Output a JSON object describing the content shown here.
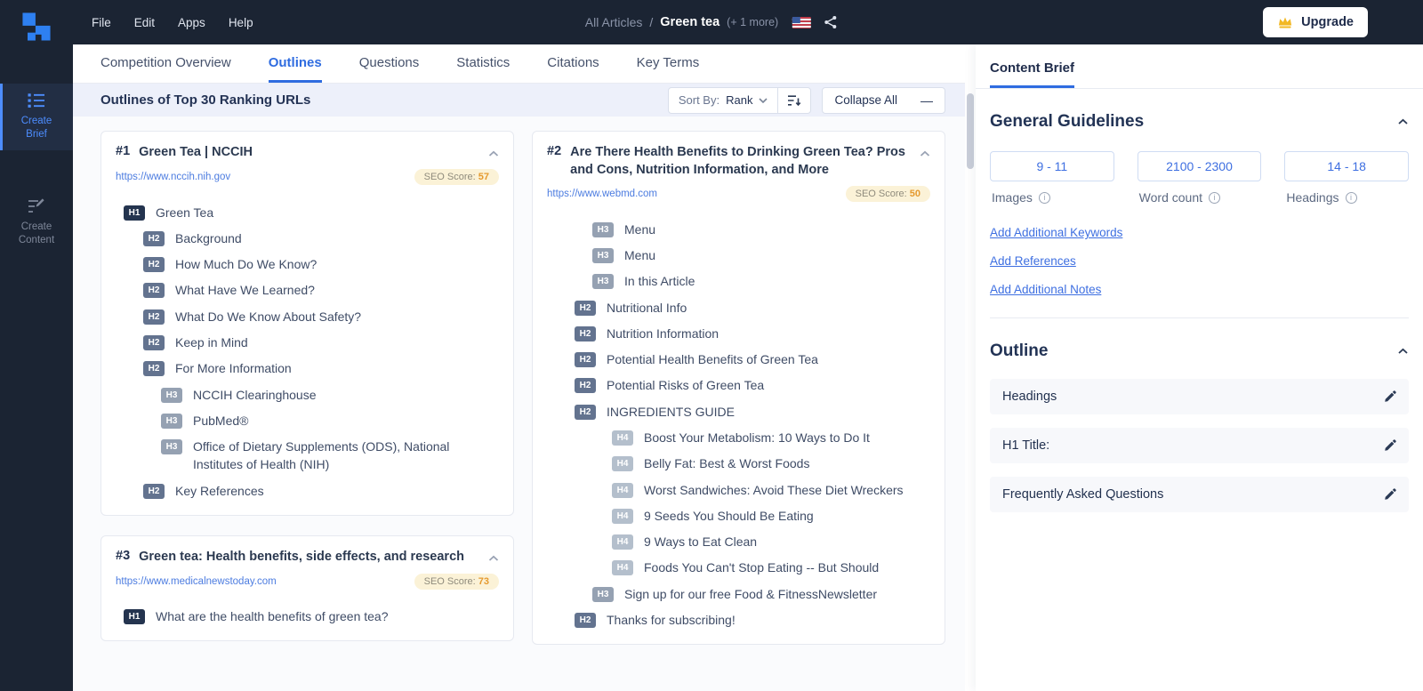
{
  "colors": {
    "accent": "#2f6ce0",
    "navy": "#1b2433",
    "seo_score": "#e59a2f",
    "link": "#3e6fe1"
  },
  "icons": {
    "minus": "—",
    "info": "i"
  },
  "topbar": {
    "menus": [
      {
        "label": "File"
      },
      {
        "label": "Edit"
      },
      {
        "label": "Apps"
      },
      {
        "label": "Help"
      }
    ],
    "breadcrumb": {
      "section": "All Articles",
      "separator": "/",
      "title": "Green tea",
      "suffix": "(+ 1 more)"
    },
    "upgrade_label": "Upgrade"
  },
  "sidebar": {
    "items": [
      {
        "label": "Create Brief"
      },
      {
        "label": "Create Content"
      }
    ]
  },
  "tabs": {
    "items": [
      {
        "label": "Competition Overview",
        "active": false
      },
      {
        "label": "Outlines",
        "active": true
      },
      {
        "label": "Questions",
        "active": false
      },
      {
        "label": "Statistics",
        "active": false
      },
      {
        "label": "Citations",
        "active": false
      },
      {
        "label": "Key Terms",
        "active": false
      }
    ]
  },
  "outlines": {
    "header": {
      "title": "Outlines of Top 30 Ranking URLs",
      "sort_by_label": "Sort By:",
      "sort_value": "Rank",
      "collapse_all_label": "Collapse All"
    },
    "columns": [
      {
        "cards": [
          {
            "rank": "#1",
            "title": "Green Tea | NCCIH",
            "url": "https://www.nccih.nih.gov",
            "seo_score_label": "SEO Score:",
            "seo_score": "57",
            "items": [
              {
                "tag": "H1",
                "text": "Green Tea"
              },
              {
                "tag": "H2",
                "text": "Background"
              },
              {
                "tag": "H2",
                "text": "How Much Do We Know?"
              },
              {
                "tag": "H2",
                "text": "What Have We Learned?"
              },
              {
                "tag": "H2",
                "text": "What Do We Know About Safety?"
              },
              {
                "tag": "H2",
                "text": "Keep in Mind"
              },
              {
                "tag": "H2",
                "text": "For More Information"
              },
              {
                "tag": "H3",
                "text": "NCCIH Clearinghouse"
              },
              {
                "tag": "H3",
                "text": "PubMed®"
              },
              {
                "tag": "H3",
                "text": "Office of Dietary Supplements (ODS), National Institutes of Health (NIH)"
              },
              {
                "tag": "H2",
                "text": "Key References"
              }
            ]
          },
          {
            "rank": "#3",
            "title": "Green tea: Health benefits, side effects, and research",
            "url": "https://www.medicalnewstoday.com",
            "seo_score_label": "SEO Score:",
            "seo_score": "73",
            "items": [
              {
                "tag": "H1",
                "text": "What are the health benefits of green tea?"
              }
            ]
          }
        ]
      },
      {
        "cards": [
          {
            "rank": "#2",
            "title": "Are There Health Benefits to Drinking Green Tea? Pros and Cons, Nutrition Information, and More",
            "url": "https://www.webmd.com",
            "seo_score_label": "SEO Score:",
            "seo_score": "50",
            "items": [
              {
                "tag": "H3",
                "text": "Menu"
              },
              {
                "tag": "H3",
                "text": "Menu"
              },
              {
                "tag": "H3",
                "text": "In this Article"
              },
              {
                "tag": "H2",
                "text": "Nutritional Info"
              },
              {
                "tag": "H2",
                "text": "Nutrition Information"
              },
              {
                "tag": "H2",
                "text": "Potential Health Benefits of Green Tea"
              },
              {
                "tag": "H2",
                "text": "Potential Risks of Green Tea"
              },
              {
                "tag": "H2",
                "text": "INGREDIENTS GUIDE"
              },
              {
                "tag": "H4",
                "text": "Boost Your Metabolism: 10 Ways to Do It"
              },
              {
                "tag": "H4",
                "text": "Belly Fat: Best & Worst Foods"
              },
              {
                "tag": "H4",
                "text": "Worst Sandwiches: Avoid These Diet Wreckers"
              },
              {
                "tag": "H4",
                "text": "9 Seeds You Should Be Eating"
              },
              {
                "tag": "H4",
                "text": "9 Ways to Eat Clean"
              },
              {
                "tag": "H4",
                "text": "Foods You Can't Stop Eating -- But Should"
              },
              {
                "tag": "H3",
                "text": "Sign up for our free Food & FitnessNewsletter"
              },
              {
                "tag": "H2",
                "text": "Thanks for subscribing!"
              }
            ]
          }
        ]
      }
    ]
  },
  "content_brief": {
    "tab_label": "Content Brief",
    "general_guidelines": {
      "title": "General Guidelines",
      "stats": [
        {
          "value": "9 - 11",
          "label": "Images"
        },
        {
          "value": "2100 - 2300",
          "label": "Word count"
        },
        {
          "value": "14 - 18",
          "label": "Headings"
        }
      ],
      "links": [
        {
          "label": "Add Additional Keywords"
        },
        {
          "label": "Add References"
        },
        {
          "label": "Add Additional Notes"
        }
      ]
    },
    "outline": {
      "title": "Outline",
      "rows": [
        {
          "label": "Headings"
        },
        {
          "label": "H1 Title:"
        },
        {
          "label": "Frequently Asked Questions"
        }
      ]
    }
  }
}
